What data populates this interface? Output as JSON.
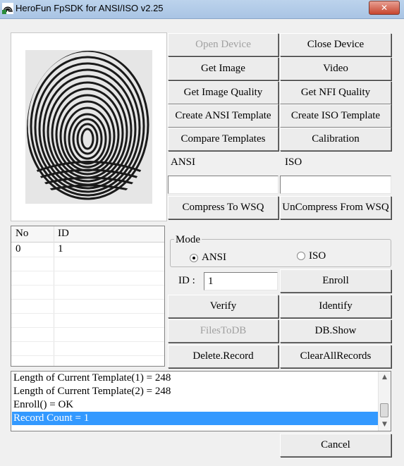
{
  "window": {
    "title": "HeroFun FpSDK for ANSI/ISO v2.25",
    "close_glyph": "✕"
  },
  "buttons": {
    "open_device": "Open Device",
    "close_device": "Close Device",
    "get_image": "Get Image",
    "video": "Video",
    "get_image_quality": "Get Image Quality",
    "get_nfi_quality": "Get NFI Quality",
    "create_ansi": "Create ANSI Template",
    "create_iso": "Create ISO Template",
    "compare": "Compare Templates",
    "calibration": "Calibration",
    "compress_wsq": "Compress To WSQ",
    "uncompress_wsq": "UnCompress From WSQ",
    "enroll": "Enroll",
    "verify": "Verify",
    "identify": "Identify",
    "files_to_db": "FilesToDB",
    "db_show": "DB.Show",
    "delete_record": "Delete.Record",
    "clear_all": "ClearAllRecords",
    "cancel": "Cancel"
  },
  "labels": {
    "ansi": "ANSI",
    "iso": "ISO",
    "id": "ID :"
  },
  "fields": {
    "ansi_value": "",
    "iso_value": "",
    "id_value": "1"
  },
  "mode": {
    "title": "Mode",
    "option_ansi": "ANSI",
    "option_iso": "ISO",
    "selected": "ANSI"
  },
  "table": {
    "columns": [
      "No",
      "ID"
    ],
    "rows": [
      [
        "0",
        "1"
      ]
    ]
  },
  "log": {
    "lines": [
      "Length of Current Template(1) = 248",
      "Length of Current Template(2) = 248",
      "Enroll() = OK",
      "Record Count = 1"
    ],
    "selected_index": 3
  },
  "icons": {
    "app": "fingerprint-app-icon",
    "scroll_up": "▲",
    "scroll_down": "▼"
  }
}
